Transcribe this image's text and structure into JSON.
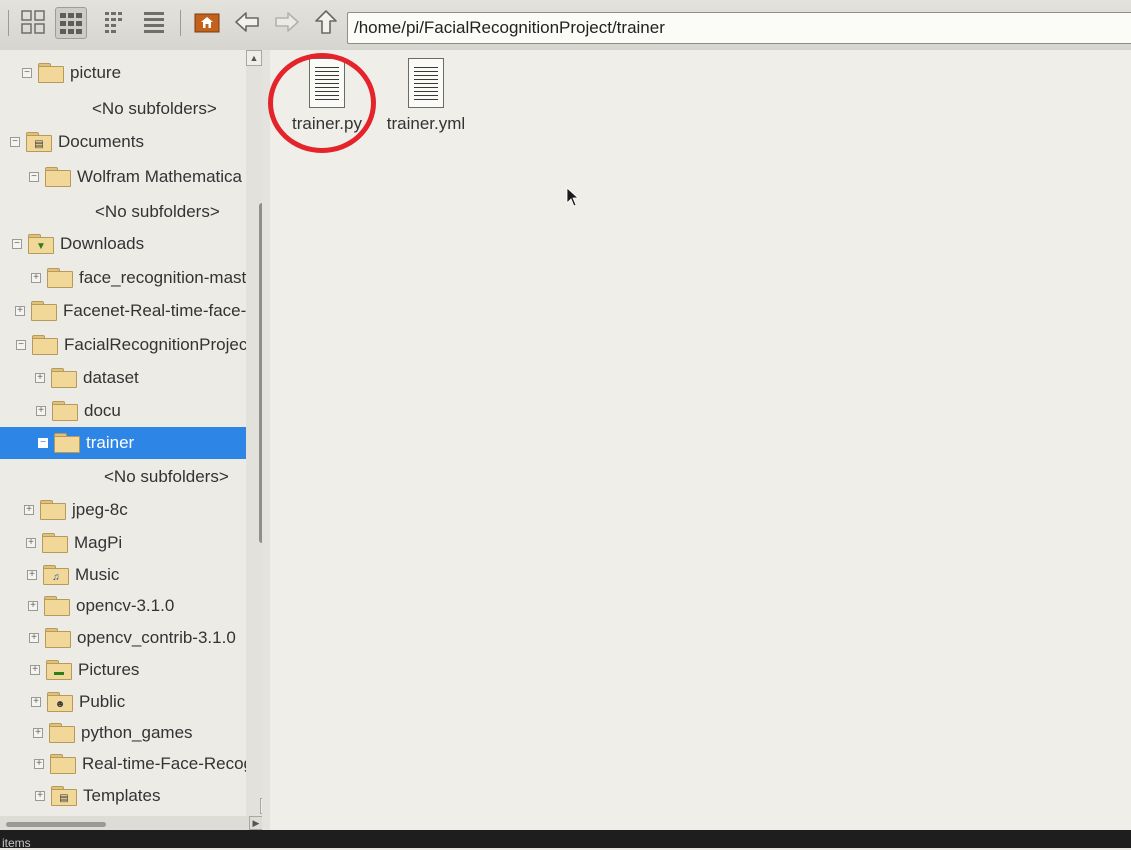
{
  "toolbar": {
    "buttons": [
      {
        "name": "icon-view-button",
        "icon": "icon-view-icon"
      },
      {
        "name": "thumbnail-view-button",
        "icon": "thumbnail-view-icon"
      },
      {
        "name": "compact-view-button",
        "icon": "compact-view-icon"
      },
      {
        "name": "detail-view-button",
        "icon": "detail-view-icon"
      },
      {
        "name": "home-button",
        "icon": "home-icon"
      },
      {
        "name": "back-button",
        "icon": "arrow-left-icon"
      },
      {
        "name": "forward-button",
        "icon": "arrow-right-icon"
      },
      {
        "name": "up-button",
        "icon": "arrow-up-icon"
      }
    ],
    "address": "/home/pi/FacialRecognitionProject/trainer"
  },
  "sidebar": {
    "items": [
      {
        "label": "picture"
      },
      {
        "label": "<No subfolders>"
      },
      {
        "label": "Documents"
      },
      {
        "label": "Wolfram Mathematica"
      },
      {
        "label": "<No subfolders>"
      },
      {
        "label": "Downloads"
      },
      {
        "label": "face_recognition-mast"
      },
      {
        "label": "Facenet-Real-time-face-"
      },
      {
        "label": "FacialRecognitionProjec"
      },
      {
        "label": "dataset"
      },
      {
        "label": "docu"
      },
      {
        "label": "trainer"
      },
      {
        "label": "<No subfolders>"
      },
      {
        "label": "jpeg-8c"
      },
      {
        "label": "MagPi"
      },
      {
        "label": "Music"
      },
      {
        "label": "opencv-3.1.0"
      },
      {
        "label": "opencv_contrib-3.1.0"
      },
      {
        "label": "Pictures"
      },
      {
        "label": "Public"
      },
      {
        "label": "python_games"
      },
      {
        "label": "Real-time-Face-Recogni"
      },
      {
        "label": "Templates"
      }
    ],
    "selected": "trainer"
  },
  "files": [
    {
      "name": "trainer.py",
      "highlighted": true
    },
    {
      "name": "trainer.yml",
      "highlighted": false
    }
  ],
  "colors": {
    "selection": "#2d86e6",
    "highlight_circle": "#e4232a"
  },
  "status": {
    "text": "items"
  }
}
